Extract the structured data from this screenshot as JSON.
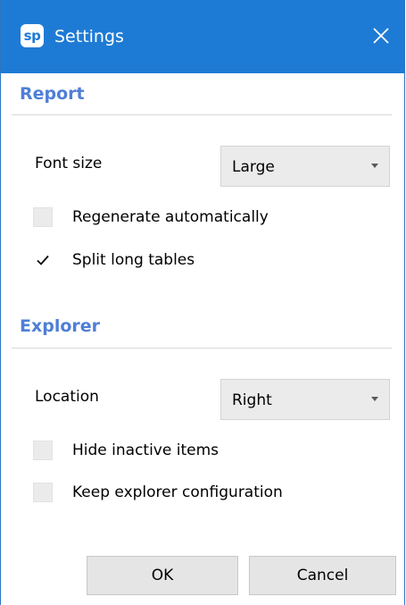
{
  "window": {
    "logo_text": "sp",
    "title": "Settings"
  },
  "report": {
    "heading": "Report",
    "font_size_label": "Font size",
    "font_size_value": "Large",
    "regenerate_label": "Regenerate automatically",
    "regenerate_checked": false,
    "split_tables_label": "Split long tables",
    "split_tables_checked": true
  },
  "explorer": {
    "heading": "Explorer",
    "location_label": "Location",
    "location_value": "Right",
    "hide_inactive_label": "Hide inactive items",
    "hide_inactive_checked": false,
    "keep_config_label": "Keep explorer configuration",
    "keep_config_checked": false
  },
  "buttons": {
    "ok": "OK",
    "cancel": "Cancel"
  },
  "colors": {
    "titlebar": "#1e7bd5",
    "heading": "#4f7fd6"
  }
}
